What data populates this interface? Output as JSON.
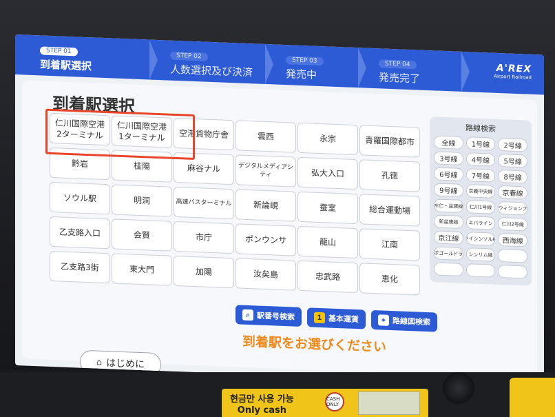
{
  "header": {
    "steps": [
      {
        "no": "STEP 01",
        "title": "到着駅選択"
      },
      {
        "no": "STEP 02",
        "title": "人数選択及び決済"
      },
      {
        "no": "STEP 03",
        "title": "発売中"
      },
      {
        "no": "STEP 04",
        "title": "発売完了"
      }
    ],
    "logo": "A'REX",
    "logo_sub": "Airport Railroad"
  },
  "main": {
    "title": "到着駅選択",
    "stations": [
      "仁川国際空港\n2ターミナル",
      "仁川国際空港\n1ターミナル",
      "空港貨物庁舎",
      "雲西",
      "永宗",
      "青羅国際都市",
      "黔岩",
      "桂陽",
      "麻谷ナル",
      "デジタルメディアシティ",
      "弘大入口",
      "孔徳",
      "ソウル駅",
      "明洞",
      "高速バスターミナル",
      "新論峴",
      "蚕室",
      "総合運動場",
      "乙支路入口",
      "会賢",
      "市庁",
      "ポンウンサ",
      "龍山",
      "江南",
      "乙支路3街",
      "東大門",
      "加陽",
      "汝矣島",
      "忠武路",
      "恵化"
    ],
    "line_search": {
      "title": "路線検索",
      "lines": [
        "全線",
        "1号線",
        "2号線",
        "3号線",
        "4号線",
        "5号線",
        "6号線",
        "7号線",
        "8号線",
        "9号線",
        "京義中央線",
        "京春線",
        "水仁・盆唐線",
        "仁川1号線",
        "ウィジョンブ",
        "新盆唐線",
        "エバライン",
        "仁川2号線",
        "京江線",
        "ウイシンソル線",
        "西海線",
        "キンポゴールドライン",
        "シンリム線",
        ""
      ]
    },
    "actions": {
      "station_no_search": "駅番号検索",
      "basic_fare": "基本運賃",
      "map_search": "路線図検索"
    },
    "prompt": "到着駅をお選びください",
    "home_button": "はじめに"
  },
  "kiosk": {
    "cash_only_ko": "현금만 사용 가능",
    "cash_only_en": "Only cash",
    "no_card": "CASH ONLY"
  }
}
